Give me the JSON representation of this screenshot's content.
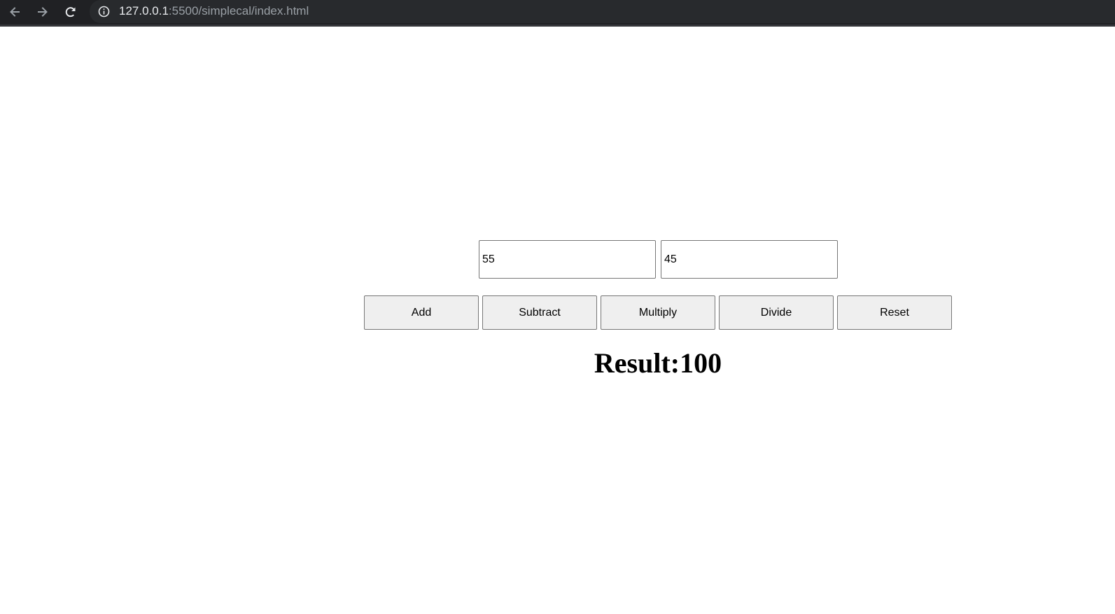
{
  "browser": {
    "url_host": "127.0.0.1",
    "url_path": ":5500/simplecal/index.html",
    "icons": {
      "back": "back-arrow-icon",
      "forward": "forward-arrow-icon",
      "reload": "reload-icon",
      "info": "info-icon"
    }
  },
  "calculator": {
    "input1_value": "55",
    "input2_value": "45",
    "buttons": {
      "add": "Add",
      "subtract": "Subtract",
      "multiply": "Multiply",
      "divide": "Divide",
      "reset": "Reset"
    },
    "result_text": "Result:100"
  },
  "colors": {
    "browser_bar": "#202124",
    "button_bg": "#efefef",
    "page_bg": "#ffffff"
  }
}
